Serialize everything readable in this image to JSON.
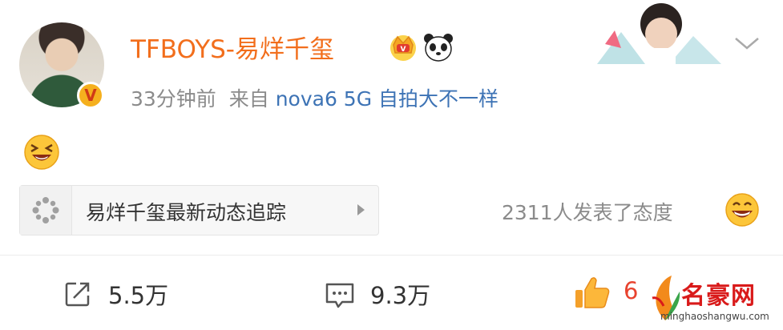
{
  "post": {
    "username": "TFBOYS-易烊千玺",
    "verified_badge": "V",
    "time": "33分钟前",
    "source_prefix": "来自",
    "source": "nova6 5G 自拍大不一样",
    "topic_label": "易烊千玺最新动态追踪",
    "attitude_text": "2311人发表了态度"
  },
  "actions": {
    "share_count": "5.5万",
    "comment_count": "9.3万",
    "like_count": "6"
  },
  "watermark": {
    "title": "名豪网",
    "url": "minghaoshangwu.com"
  },
  "icons": [
    "crown-icon",
    "panda-icon",
    "chevron-down-icon",
    "laugh-emoji-icon",
    "topic-icon",
    "smile-emoji-icon",
    "share-icon",
    "comment-icon",
    "like-icon"
  ],
  "colors": {
    "username": "#f26e1c",
    "source_link": "#3d73b5",
    "meta_gray": "#8b8b8b",
    "like_red": "#e8432f"
  }
}
